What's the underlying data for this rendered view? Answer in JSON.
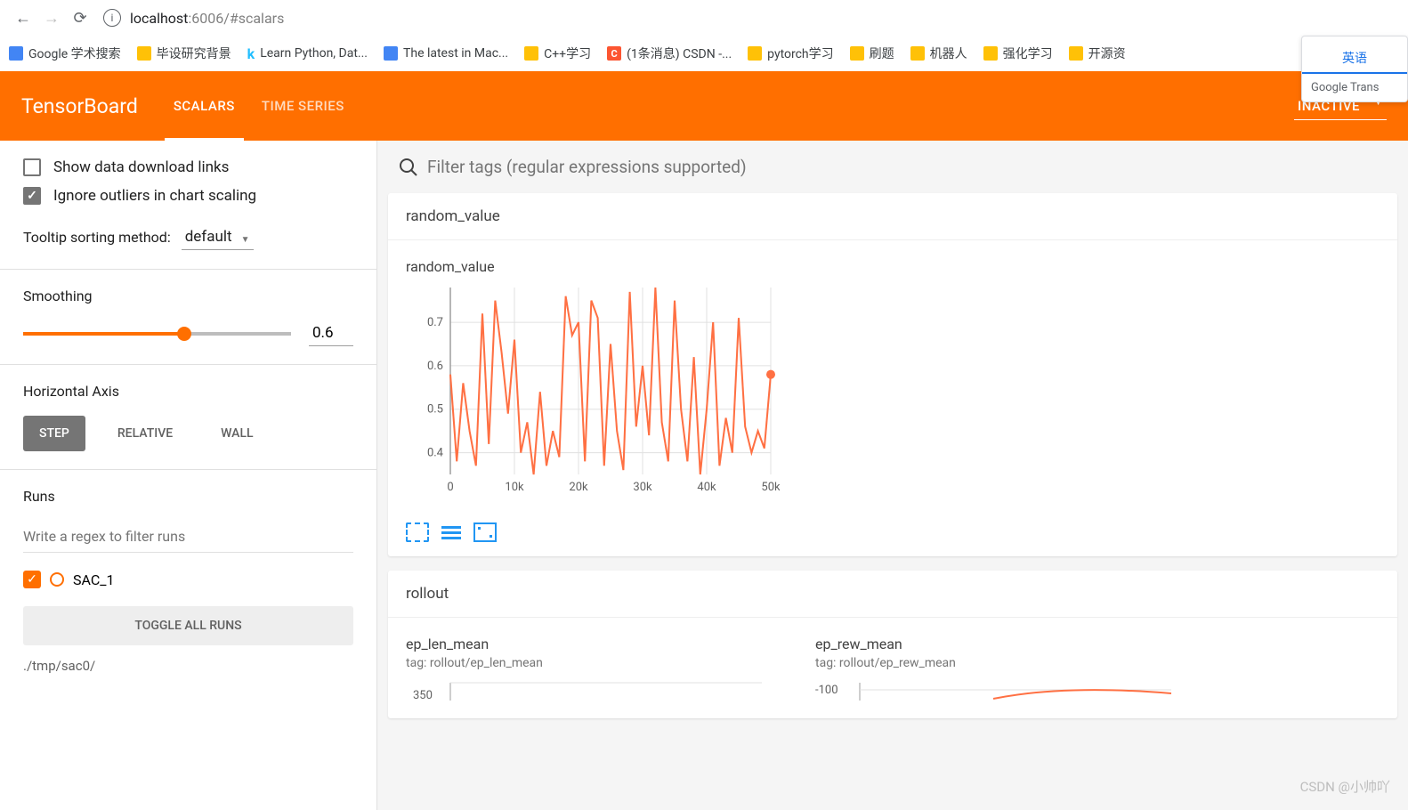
{
  "browser": {
    "url_host": "localhost",
    "url_rest": ":6006/#scalars",
    "bookmarks": [
      {
        "icon": "blue",
        "label": "Google 学术搜索"
      },
      {
        "icon": "folder",
        "label": "毕设研究背景"
      },
      {
        "icon": "k",
        "label": "Learn Python, Dat..."
      },
      {
        "icon": "blue",
        "label": "The latest in Mac..."
      },
      {
        "icon": "folder",
        "label": "C++学习"
      },
      {
        "icon": "c",
        "label": "(1条消息) CSDN -..."
      },
      {
        "icon": "folder",
        "label": "pytorch学习"
      },
      {
        "icon": "folder",
        "label": "刷题"
      },
      {
        "icon": "folder",
        "label": "机器人"
      },
      {
        "icon": "folder",
        "label": "强化学习"
      },
      {
        "icon": "folder",
        "label": "开源资"
      }
    ],
    "translate_lang": "英语",
    "translate_brand": "Google Trans"
  },
  "header": {
    "logo": "TensorBoard",
    "tabs": [
      "SCALARS",
      "TIME SERIES"
    ],
    "active_tab": 0,
    "inactive_label": "INACTIVE"
  },
  "sidebar": {
    "show_download": {
      "label": "Show data download links",
      "checked": false
    },
    "ignore_outliers": {
      "label": "Ignore outliers in chart scaling",
      "checked": true
    },
    "tooltip_label": "Tooltip sorting method:",
    "tooltip_value": "default",
    "smoothing_label": "Smoothing",
    "smoothing_value": "0.6",
    "axis_label": "Horizontal Axis",
    "axis_buttons": [
      "STEP",
      "RELATIVE",
      "WALL"
    ],
    "axis_active": 0,
    "runs_label": "Runs",
    "runs_filter_placeholder": "Write a regex to filter runs",
    "runs": [
      {
        "name": "SAC_1",
        "color": "#ff6f00",
        "checked": true
      }
    ],
    "toggle_label": "TOGGLE ALL RUNS",
    "run_path": "./tmp/sac0/"
  },
  "content": {
    "filter_placeholder": "Filter tags (regular expressions supported)",
    "cards": [
      {
        "header": "random_value",
        "charts": [
          {
            "title": "random_value",
            "subtitle": ""
          }
        ]
      },
      {
        "header": "rollout",
        "charts": [
          {
            "title": "ep_len_mean",
            "subtitle": "tag: rollout/ep_len_mean"
          },
          {
            "title": "ep_rew_mean",
            "subtitle": "tag: rollout/ep_rew_mean"
          }
        ]
      }
    ]
  },
  "chart_data": {
    "type": "line",
    "title": "random_value",
    "xlabel": "",
    "ylabel": "",
    "xlim": [
      0,
      50000
    ],
    "ylim": [
      0.35,
      0.78
    ],
    "x_ticks": [
      0,
      10000,
      20000,
      30000,
      40000,
      50000
    ],
    "x_tick_labels": [
      "0",
      "10k",
      "20k",
      "30k",
      "40k",
      "50k"
    ],
    "y_ticks": [
      0.4,
      0.5,
      0.6,
      0.7
    ],
    "series": [
      {
        "name": "SAC_1",
        "color": "#ff7043",
        "x": [
          0,
          1000,
          2000,
          3000,
          4000,
          5000,
          6000,
          7000,
          8000,
          9000,
          10000,
          11000,
          12000,
          13000,
          14000,
          15000,
          16000,
          17000,
          18000,
          19000,
          20000,
          21000,
          22000,
          23000,
          24000,
          25000,
          26000,
          27000,
          28000,
          29000,
          30000,
          31000,
          32000,
          33000,
          34000,
          35000,
          36000,
          37000,
          38000,
          39000,
          40000,
          41000,
          42000,
          43000,
          44000,
          45000,
          46000,
          47000,
          48000,
          49000,
          50000
        ],
        "y": [
          0.58,
          0.38,
          0.56,
          0.45,
          0.37,
          0.72,
          0.42,
          0.75,
          0.63,
          0.49,
          0.66,
          0.4,
          0.47,
          0.35,
          0.54,
          0.37,
          0.45,
          0.39,
          0.76,
          0.67,
          0.7,
          0.38,
          0.75,
          0.71,
          0.37,
          0.65,
          0.45,
          0.36,
          0.77,
          0.46,
          0.6,
          0.44,
          0.78,
          0.47,
          0.38,
          0.75,
          0.5,
          0.38,
          0.62,
          0.35,
          0.5,
          0.7,
          0.37,
          0.48,
          0.4,
          0.71,
          0.46,
          0.4,
          0.45,
          0.41,
          0.58
        ]
      }
    ],
    "end_marker": {
      "x": 50000,
      "y": 0.58,
      "color": "#ff7043"
    }
  },
  "watermark": "CSDN @小帅吖"
}
